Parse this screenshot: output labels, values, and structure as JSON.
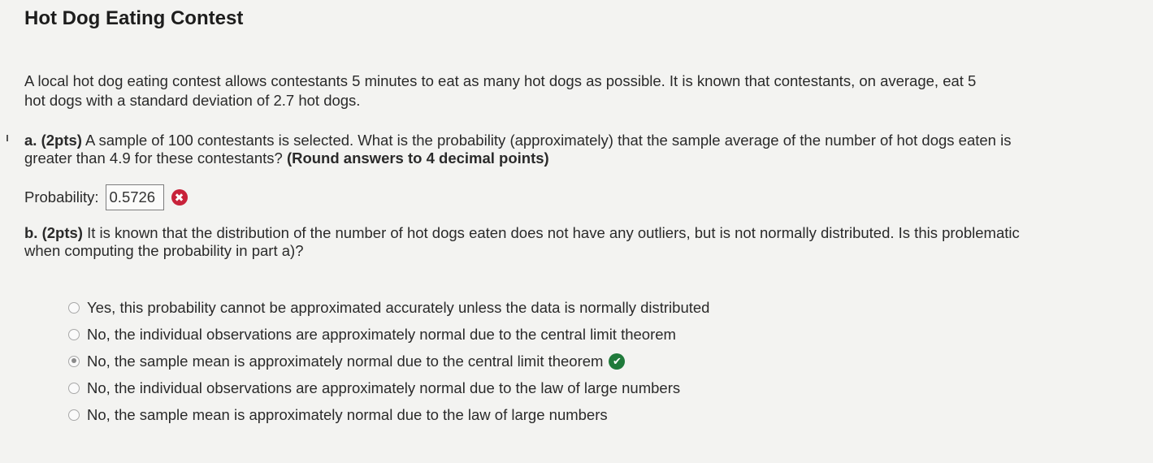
{
  "title": "Hot Dog Eating Contest",
  "intro": "A local hot dog eating contest allows contestants 5 minutes to eat as many hot dogs as possible.  It is known that contestants, on average, eat 5 hot dogs with a standard deviation of 2.7 hot dogs.",
  "part_a": {
    "label": "a. (2pts)",
    "text": " A sample of 100 contestants is selected.  What is the probability (approximately) that the sample average of the number of hot dogs eaten is greater than 4.9 for these contestants? ",
    "emphasis": "(Round answers to 4 decimal points)",
    "answer_label": "Probability:",
    "answer_value": "0.5726",
    "answer_status_icon": "✖"
  },
  "part_b": {
    "label": "b. (2pts)",
    "text": " It is known that the distribution of the number of hot dogs eaten does not have any outliers, but is not normally distributed.  Is this problematic when computing the probability in part a)?",
    "options": [
      {
        "label": "Yes, this probability cannot be approximated accurately unless the data is normally distributed",
        "selected": false
      },
      {
        "label": "No, the individual observations are approximately normal due to the central limit theorem",
        "selected": false
      },
      {
        "label": "No, the sample mean is approximately normal due to the central limit theorem",
        "selected": true
      },
      {
        "label": "No, the individual observations are approximately normal due to the law of large numbers",
        "selected": false
      },
      {
        "label": "No, the sample mean is approximately normal due to the law of large numbers",
        "selected": false
      }
    ],
    "correct_status_icon": "✔"
  },
  "colors": {
    "background": "#f3f3f1",
    "wrong": "#c8223a",
    "correct": "#1f7a3a"
  }
}
